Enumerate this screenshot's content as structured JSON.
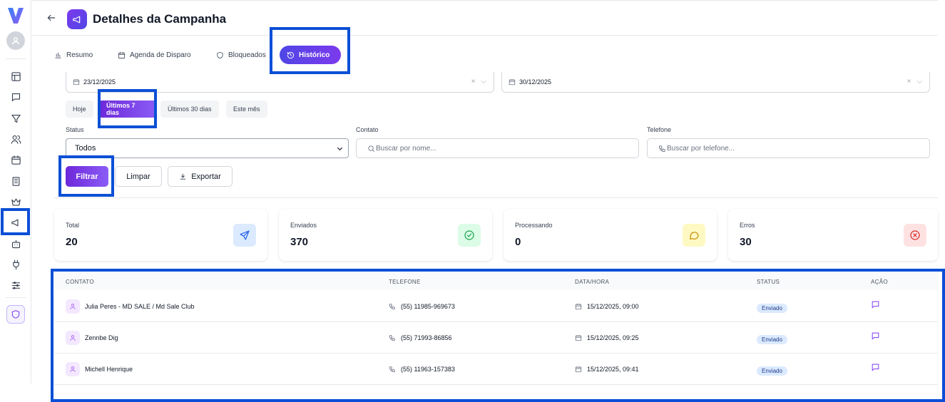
{
  "header": {
    "title": "Detalhes da Campanha"
  },
  "tabs": [
    {
      "label": "Resumo",
      "icon": "bar-chart-icon"
    },
    {
      "label": "Agenda de Disparo",
      "icon": "calendar-icon"
    },
    {
      "label": "Bloqueados",
      "icon": "shield-icon"
    },
    {
      "label": "Histórico",
      "icon": "history-icon",
      "active": true
    }
  ],
  "filters": {
    "date_from": "23/12/2025",
    "date_to": "30/12/2025",
    "quick_ranges": [
      "Hoje",
      "Últimos 7 dias",
      "Últimos 30 dias",
      "Este mês"
    ],
    "active_range": "Últimos 7 dias",
    "status_label": "Status",
    "status_value": "Todos",
    "contact_label": "Contato",
    "contact_placeholder": "Buscar por nome...",
    "phone_label": "Telefone",
    "phone_placeholder": "Buscar por telefone...",
    "filter_button": "Filtrar",
    "clear_button": "Limpar",
    "export_button": "Exportar"
  },
  "stats": [
    {
      "label": "Total",
      "value": "20",
      "icon": "send-icon",
      "color": "#dbeafe"
    },
    {
      "label": "Enviados",
      "value": "370",
      "icon": "check-circle-icon",
      "color": "#dcfce7"
    },
    {
      "label": "Processando",
      "value": "0",
      "icon": "message-circle-icon",
      "color": "#fef9c3"
    },
    {
      "label": "Erros",
      "value": "30",
      "icon": "x-circle-icon",
      "color": "#fee2e2"
    }
  ],
  "table": {
    "columns": [
      "CONTATO",
      "TELEFONE",
      "DATA/HORA",
      "STATUS",
      "AÇÃO"
    ],
    "rows": [
      {
        "contact": "Julia Peres - MD SALE / Md Sale Club",
        "phone": "(55) 11985-969673",
        "datetime": "15/12/2025, 09:00",
        "status": "Enviado"
      },
      {
        "contact": "Zennbe Dig",
        "phone": "(55) 71993-86856",
        "datetime": "15/12/2025, 09:25",
        "status": "Enviado"
      },
      {
        "contact": "Michell Henrique",
        "phone": "(55) 11963-157383",
        "datetime": "15/12/2025, 09:41",
        "status": "Enviado"
      }
    ]
  },
  "colors": {
    "accent": "#7c3aed",
    "highlight": "#0b4fd6"
  }
}
